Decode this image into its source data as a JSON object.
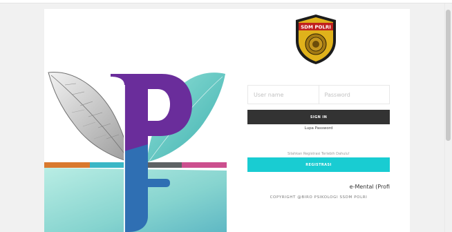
{
  "brand": {
    "badge_text": "SDM POLRI",
    "colors": {
      "purple": "#6a2d9b",
      "teal": "#55c2bb",
      "blue": "#2f6fb3",
      "signin": "#333333",
      "register": "#19ccd2"
    }
  },
  "login": {
    "username_placeholder": "User name",
    "password_placeholder": "Password",
    "signin_label": "SIGN IN",
    "forgot_label": "Lupa Password"
  },
  "register": {
    "note": "Silahkan Registrasi Terlebih Dahulu!",
    "button_label": "REGISTRASI"
  },
  "footer": {
    "marquee_text": "e-Mental (Profi",
    "copyright": "COPYRIGHT @BIRO PSIKOLOGI SSDM POLRI"
  }
}
